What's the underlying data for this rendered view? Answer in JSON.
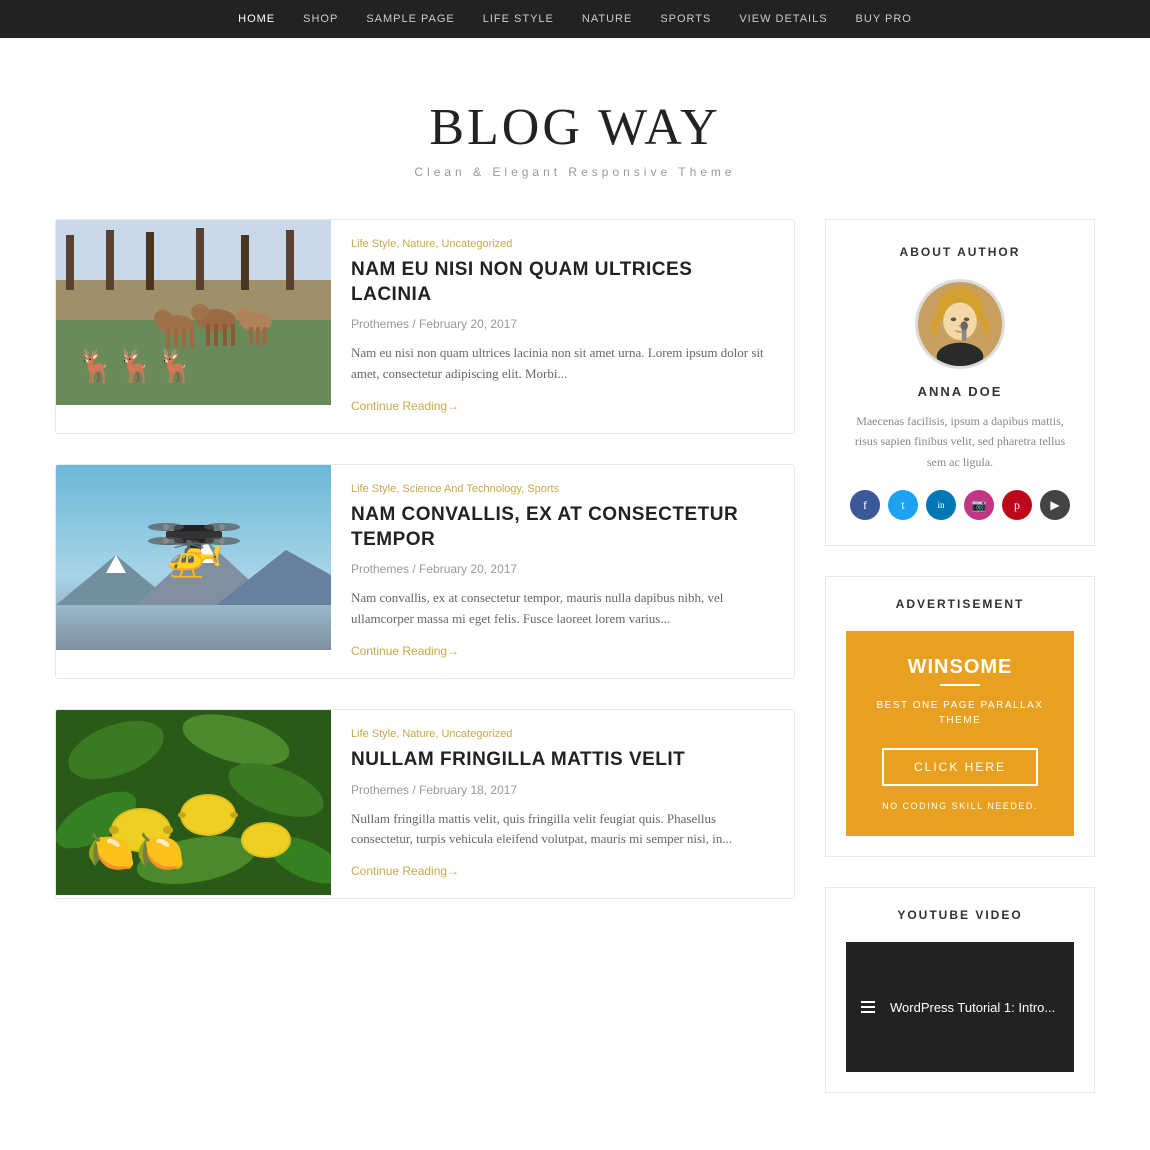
{
  "nav": {
    "items": [
      {
        "label": "HOME",
        "active": true
      },
      {
        "label": "SHOP",
        "active": false
      },
      {
        "label": "SAMPLE PAGE",
        "active": false
      },
      {
        "label": "LIFE STYLE",
        "active": false
      },
      {
        "label": "NATURE",
        "active": false
      },
      {
        "label": "SPORTS",
        "active": false
      },
      {
        "label": "VIEW DETAILS",
        "active": false
      },
      {
        "label": "BUY PRO",
        "active": false
      }
    ]
  },
  "site": {
    "title": "BLOG WAY",
    "tagline": "Clean & Elegant Responsive Theme"
  },
  "articles": [
    {
      "categories": "Life Style, Nature, Uncategorized",
      "title": "NAM EU NISI NON QUAM ULTRICES LACINIA",
      "author": "Prothemes",
      "date": "February 20, 2017",
      "excerpt": "Nam eu nisi non quam ultrices lacinia non sit amet urna. Lorem ipsum dolor sit amet, consectetur adipiscing elit. Morbi...",
      "read_more": "Continue Reading→",
      "image_type": "deer"
    },
    {
      "categories": "Life Style, Science And Technology, Sports",
      "title": "NAM CONVALLIS, EX AT CONSECTETUR TEMPOR",
      "author": "Prothemes",
      "date": "February 20, 2017",
      "excerpt": "Nam convallis, ex at consectetur tempor, mauris nulla dapibus nibh, vel ullamcorper massa mi eget felis. Fusce laoreet lorem varius...",
      "read_more": "Continue Reading→",
      "image_type": "drone"
    },
    {
      "categories": "Life Style, Nature, Uncategorized",
      "title": "NULLAM FRINGILLA MATTIS VELIT",
      "author": "Prothemes",
      "date": "February 18, 2017",
      "excerpt": "Nullam fringilla mattis velit, quis fringilla velit feugiat quis. Phasellus consectetur, turpis vehicula eleifend volutpat, mauris mi semper nisi, in...",
      "read_more": "Continue Reading→",
      "image_type": "lemon"
    }
  ],
  "sidebar": {
    "about": {
      "section_title": "ABOUT AUTHOR",
      "author_name": "ANNA DOE",
      "bio": "Maecenas facilisis, ipsum a dapibus mattis, risus sapien finibus velit, sed pharetra tellus sem ac ligula.",
      "social": [
        {
          "icon": "facebook-icon",
          "glyph": "f"
        },
        {
          "icon": "twitter-icon",
          "glyph": "t"
        },
        {
          "icon": "linkedin-icon",
          "glyph": "in"
        },
        {
          "icon": "instagram-icon",
          "glyph": "📷"
        },
        {
          "icon": "pinterest-icon",
          "glyph": "p"
        },
        {
          "icon": "youtube-icon",
          "glyph": "▶"
        }
      ]
    },
    "advertisement": {
      "section_title": "ADVERTISEMENT",
      "ad_title": "WINSOME",
      "ad_subtitle": "BEST ONE PAGE PARALLAX THEME",
      "button_label": "CLICK HERE",
      "note": "NO CODING SKILL NEEDED."
    },
    "youtube": {
      "section_title": "YOUTUBE VIDEO",
      "video_title": "WordPress Tutorial 1: Intro..."
    }
  }
}
